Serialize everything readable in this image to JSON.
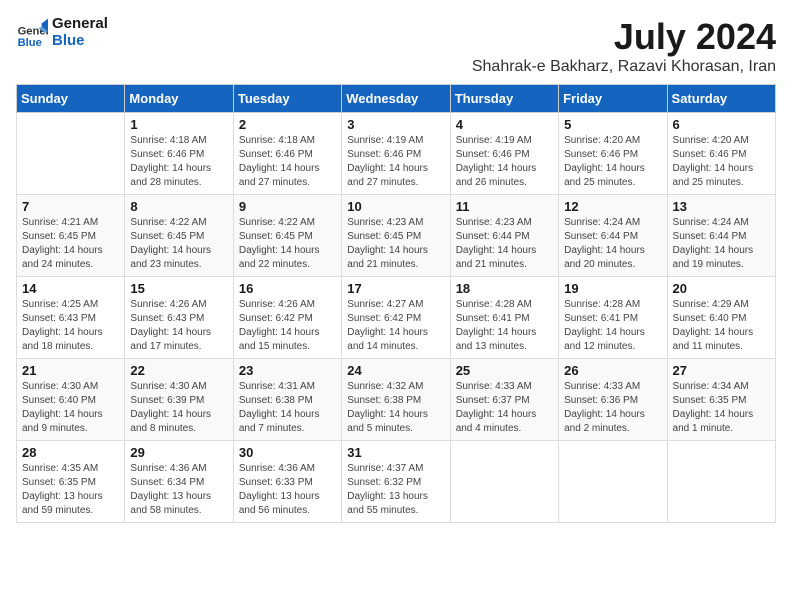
{
  "logo": {
    "line1": "General",
    "line2": "Blue"
  },
  "title": "July 2024",
  "subtitle": "Shahrak-e Bakharz, Razavi Khorasan, Iran",
  "days_of_week": [
    "Sunday",
    "Monday",
    "Tuesday",
    "Wednesday",
    "Thursday",
    "Friday",
    "Saturday"
  ],
  "weeks": [
    [
      {
        "day": "",
        "detail": ""
      },
      {
        "day": "1",
        "detail": "Sunrise: 4:18 AM\nSunset: 6:46 PM\nDaylight: 14 hours\nand 28 minutes."
      },
      {
        "day": "2",
        "detail": "Sunrise: 4:18 AM\nSunset: 6:46 PM\nDaylight: 14 hours\nand 27 minutes."
      },
      {
        "day": "3",
        "detail": "Sunrise: 4:19 AM\nSunset: 6:46 PM\nDaylight: 14 hours\nand 27 minutes."
      },
      {
        "day": "4",
        "detail": "Sunrise: 4:19 AM\nSunset: 6:46 PM\nDaylight: 14 hours\nand 26 minutes."
      },
      {
        "day": "5",
        "detail": "Sunrise: 4:20 AM\nSunset: 6:46 PM\nDaylight: 14 hours\nand 25 minutes."
      },
      {
        "day": "6",
        "detail": "Sunrise: 4:20 AM\nSunset: 6:46 PM\nDaylight: 14 hours\nand 25 minutes."
      }
    ],
    [
      {
        "day": "7",
        "detail": "Sunrise: 4:21 AM\nSunset: 6:45 PM\nDaylight: 14 hours\nand 24 minutes."
      },
      {
        "day": "8",
        "detail": "Sunrise: 4:22 AM\nSunset: 6:45 PM\nDaylight: 14 hours\nand 23 minutes."
      },
      {
        "day": "9",
        "detail": "Sunrise: 4:22 AM\nSunset: 6:45 PM\nDaylight: 14 hours\nand 22 minutes."
      },
      {
        "day": "10",
        "detail": "Sunrise: 4:23 AM\nSunset: 6:45 PM\nDaylight: 14 hours\nand 21 minutes."
      },
      {
        "day": "11",
        "detail": "Sunrise: 4:23 AM\nSunset: 6:44 PM\nDaylight: 14 hours\nand 21 minutes."
      },
      {
        "day": "12",
        "detail": "Sunrise: 4:24 AM\nSunset: 6:44 PM\nDaylight: 14 hours\nand 20 minutes."
      },
      {
        "day": "13",
        "detail": "Sunrise: 4:24 AM\nSunset: 6:44 PM\nDaylight: 14 hours\nand 19 minutes."
      }
    ],
    [
      {
        "day": "14",
        "detail": "Sunrise: 4:25 AM\nSunset: 6:43 PM\nDaylight: 14 hours\nand 18 minutes."
      },
      {
        "day": "15",
        "detail": "Sunrise: 4:26 AM\nSunset: 6:43 PM\nDaylight: 14 hours\nand 17 minutes."
      },
      {
        "day": "16",
        "detail": "Sunrise: 4:26 AM\nSunset: 6:42 PM\nDaylight: 14 hours\nand 15 minutes."
      },
      {
        "day": "17",
        "detail": "Sunrise: 4:27 AM\nSunset: 6:42 PM\nDaylight: 14 hours\nand 14 minutes."
      },
      {
        "day": "18",
        "detail": "Sunrise: 4:28 AM\nSunset: 6:41 PM\nDaylight: 14 hours\nand 13 minutes."
      },
      {
        "day": "19",
        "detail": "Sunrise: 4:28 AM\nSunset: 6:41 PM\nDaylight: 14 hours\nand 12 minutes."
      },
      {
        "day": "20",
        "detail": "Sunrise: 4:29 AM\nSunset: 6:40 PM\nDaylight: 14 hours\nand 11 minutes."
      }
    ],
    [
      {
        "day": "21",
        "detail": "Sunrise: 4:30 AM\nSunset: 6:40 PM\nDaylight: 14 hours\nand 9 minutes."
      },
      {
        "day": "22",
        "detail": "Sunrise: 4:30 AM\nSunset: 6:39 PM\nDaylight: 14 hours\nand 8 minutes."
      },
      {
        "day": "23",
        "detail": "Sunrise: 4:31 AM\nSunset: 6:38 PM\nDaylight: 14 hours\nand 7 minutes."
      },
      {
        "day": "24",
        "detail": "Sunrise: 4:32 AM\nSunset: 6:38 PM\nDaylight: 14 hours\nand 5 minutes."
      },
      {
        "day": "25",
        "detail": "Sunrise: 4:33 AM\nSunset: 6:37 PM\nDaylight: 14 hours\nand 4 minutes."
      },
      {
        "day": "26",
        "detail": "Sunrise: 4:33 AM\nSunset: 6:36 PM\nDaylight: 14 hours\nand 2 minutes."
      },
      {
        "day": "27",
        "detail": "Sunrise: 4:34 AM\nSunset: 6:35 PM\nDaylight: 14 hours\nand 1 minute."
      }
    ],
    [
      {
        "day": "28",
        "detail": "Sunrise: 4:35 AM\nSunset: 6:35 PM\nDaylight: 13 hours\nand 59 minutes."
      },
      {
        "day": "29",
        "detail": "Sunrise: 4:36 AM\nSunset: 6:34 PM\nDaylight: 13 hours\nand 58 minutes."
      },
      {
        "day": "30",
        "detail": "Sunrise: 4:36 AM\nSunset: 6:33 PM\nDaylight: 13 hours\nand 56 minutes."
      },
      {
        "day": "31",
        "detail": "Sunrise: 4:37 AM\nSunset: 6:32 PM\nDaylight: 13 hours\nand 55 minutes."
      },
      {
        "day": "",
        "detail": ""
      },
      {
        "day": "",
        "detail": ""
      },
      {
        "day": "",
        "detail": ""
      }
    ]
  ]
}
